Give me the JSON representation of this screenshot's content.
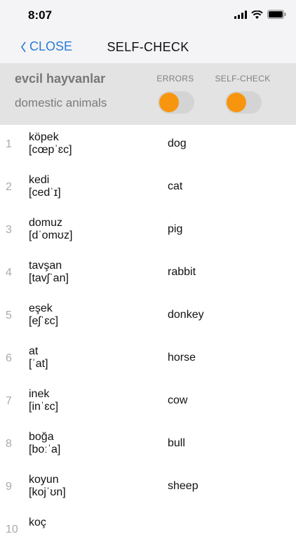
{
  "status": {
    "time": "8:07"
  },
  "nav": {
    "back_label": "CLOSE",
    "title": "SELF-CHECK"
  },
  "header": {
    "title": "evcil hayvanlar",
    "subtitle": "domestic animals",
    "errors_label": "ERRORS",
    "selfcheck_label": "SELF-CHECK"
  },
  "colors": {
    "accent": "#2a7bd8",
    "toggle_knob": "#f7960e",
    "header_bg": "#e3e3e3"
  },
  "words": [
    {
      "num": "1",
      "word": "köpek",
      "ipa": "[cœpˈɛc]",
      "trans": "dog"
    },
    {
      "num": "2",
      "word": "kedi",
      "ipa": "[cedˈɪ]",
      "trans": "cat"
    },
    {
      "num": "3",
      "word": "domuz",
      "ipa": "[dˈomʊz]",
      "trans": "pig"
    },
    {
      "num": "4",
      "word": "tavşan",
      "ipa": "[tavʃˈan]",
      "trans": "rabbit"
    },
    {
      "num": "5",
      "word": "eşek",
      "ipa": "[eʃˈɛc]",
      "trans": "donkey"
    },
    {
      "num": "6",
      "word": "at",
      "ipa": "[ˈat]",
      "trans": "horse"
    },
    {
      "num": "7",
      "word": "inek",
      "ipa": "[inˈɛc]",
      "trans": "cow"
    },
    {
      "num": "8",
      "word": "boğa",
      "ipa": "[boːˈa]",
      "trans": "bull"
    },
    {
      "num": "9",
      "word": "koyun",
      "ipa": "[kojˈʊn]",
      "trans": "sheep"
    },
    {
      "num": "10",
      "word": "koç",
      "ipa": "",
      "trans": ""
    }
  ]
}
